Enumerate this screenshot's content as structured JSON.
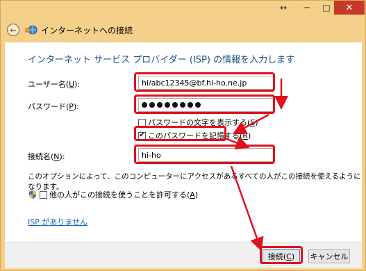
{
  "titlebar": {
    "resize_glyph": "↔",
    "minimize_glyph": "─",
    "maximize_glyph": "□",
    "close_glyph": "✕"
  },
  "nav": {
    "back_glyph": "←",
    "title": "インターネットへの接続"
  },
  "form": {
    "heading": "インターネット サービス プロバイダー (ISP) の情報を入力します",
    "username": {
      "label_prefix": "ユーザー名(",
      "label_key": "U",
      "label_suffix": "):",
      "value": "hi/abc12345@bf.hi-ho.ne.jp"
    },
    "password": {
      "label_prefix": "パスワード(",
      "label_key": "P",
      "label_suffix": "):",
      "masked_length": 8
    },
    "show_password": {
      "label_prefix": "パスワードの文字を表示する(",
      "label_key": "S",
      "label_suffix": ")",
      "checked": false
    },
    "remember_password": {
      "label_prefix": "このパスワードを記憶する(",
      "label_key": "R",
      "label_suffix": ")",
      "checked": true,
      "check_glyph": "✔"
    },
    "connection_name": {
      "label_prefix": "接続名(",
      "label_key": "N",
      "label_suffix": "):",
      "value": "hi-ho"
    },
    "info_text": "このオプションによって、このコンピューターにアクセスがあるすべての人がこの接続を使えるようになります。",
    "allow_others": {
      "label_prefix": "他の人がこの接続を使うことを許可する(",
      "label_key": "A",
      "label_suffix": ")",
      "checked": false
    },
    "no_isp_link": "ISP がありません"
  },
  "footer": {
    "connect_prefix": "接続(",
    "connect_key": "C",
    "connect_suffix": ")",
    "cancel_label": "キャンセル"
  },
  "colors": {
    "highlight": "#e0101c",
    "heading": "#1a4e8c",
    "link": "#1a63b8",
    "frame": "#f5d08a"
  }
}
